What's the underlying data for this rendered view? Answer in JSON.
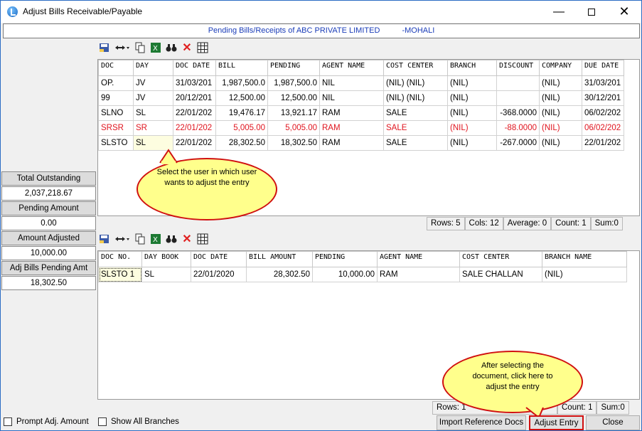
{
  "window": {
    "title": "Adjust Bills Receivable/Payable"
  },
  "header": {
    "company": "Pending Bills/Receipts of ABC PRIVATE LIMITED",
    "location": "-MOHALI"
  },
  "side": {
    "total_outstanding_label": "Total Outstanding",
    "total_outstanding_value": "2,037,218.67",
    "pending_amount_label": "Pending Amount",
    "pending_amount_value": "0.00",
    "amount_adjusted_label": "Amount Adjusted",
    "amount_adjusted_value": "10,000.00",
    "adj_pending_label": "Adj Bills Pending Amt",
    "adj_pending_value": "18,302.50"
  },
  "upper_grid": {
    "headers": [
      "DOC",
      "DAY",
      "DOC DATE",
      "BILL",
      "PENDING",
      "AGENT NAME",
      "COST CENTER",
      "BRANCH",
      "DISCOUNT",
      "COMPANY",
      "DUE DATE"
    ],
    "rows": [
      [
        "OP.",
        "JV",
        "31/03/201",
        "1,987,500.0",
        "1,987,500.0",
        "NIL",
        "(NIL) (NIL)",
        "(NIL)",
        "",
        "(NIL)",
        "31/03/201"
      ],
      [
        "99",
        "JV",
        "20/12/201",
        "12,500.00",
        "12,500.00",
        "NIL",
        "(NIL) (NIL)",
        "(NIL)",
        "",
        "(NIL)",
        "30/12/201"
      ],
      [
        "SLNO",
        "SL",
        "22/01/202",
        "19,476.17",
        "13,921.17",
        "RAM",
        "SALE",
        "(NIL)",
        "-368.0000",
        "(NIL)",
        "06/02/202"
      ],
      [
        "SRSR",
        "SR",
        "22/01/202",
        "5,005.00",
        "5,005.00",
        "RAM",
        "SALE",
        "(NIL)",
        "-88.0000",
        "(NIL)",
        "06/02/202"
      ],
      [
        "SLSTO",
        "SL",
        "22/01/202",
        "28,302.50",
        "18,302.50",
        "RAM",
        "SALE",
        "(NIL)",
        "-267.0000",
        "(NIL)",
        "22/01/202"
      ]
    ],
    "status": {
      "rows": "Rows: 5",
      "cols": "Cols: 12",
      "average": "Average: 0",
      "count": "Count: 1",
      "sum": "Sum:0"
    }
  },
  "lower_grid": {
    "headers": [
      "DOC NO.",
      "DAY BOOK",
      "DOC DATE",
      "BILL AMOUNT",
      "PENDING",
      "AGENT NAME",
      "COST CENTER",
      "BRANCH NAME"
    ],
    "rows": [
      [
        "SLSTO 1",
        "SL",
        "22/01/2020",
        "28,302.50",
        "10,000.00",
        "RAM",
        "SALE CHALLAN",
        "(NIL)"
      ]
    ],
    "status": {
      "rows": "Rows: 1",
      "count": "Count: 1",
      "sum": "Sum:0"
    }
  },
  "callouts": {
    "upper": "Select the user in which user wants to adjust the entry",
    "lower": "After selecting the document, click here to adjust the entry"
  },
  "bottom": {
    "prompt_label": "Prompt Adj. Amount",
    "show_branches_label": "Show All Branches",
    "import_button": "Import Reference Docs",
    "adjust_button": "Adjust Entry",
    "close_button": "Close"
  }
}
